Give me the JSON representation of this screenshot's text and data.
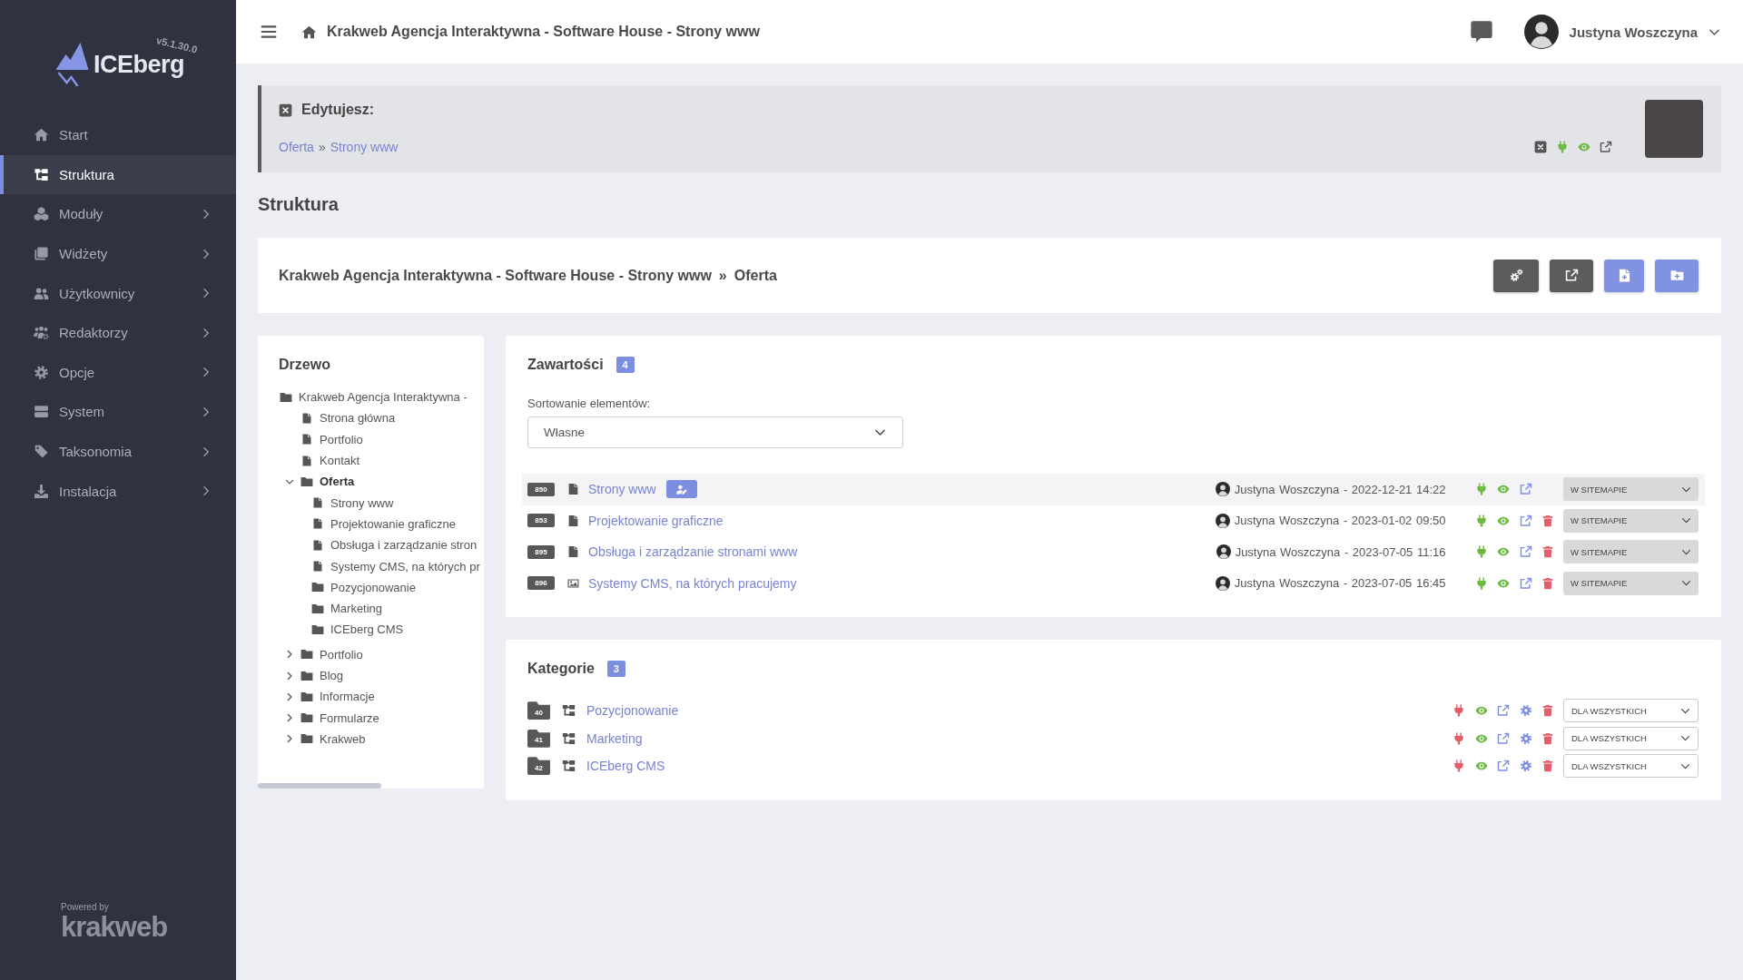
{
  "sidebar": {
    "logo": {
      "name": "ICEberg",
      "version": "v5.1.30.0"
    },
    "items": [
      {
        "label": "Start",
        "selected": false
      },
      {
        "label": "Struktura",
        "selected": true
      },
      {
        "label": "Moduły",
        "selected": false,
        "expanded": false
      },
      {
        "label": "Widżety",
        "selected": false,
        "expanded": false
      },
      {
        "label": "Użytkownicy",
        "selected": false,
        "expanded": false
      },
      {
        "label": "Redaktorzy",
        "selected": false,
        "expanded": false
      },
      {
        "label": "Opcje",
        "selected": false,
        "expanded": false
      },
      {
        "label": "System",
        "selected": false,
        "expanded": false
      },
      {
        "label": "Taksonomia",
        "selected": false,
        "expanded": false
      },
      {
        "label": "Instalacja",
        "selected": false,
        "expanded": false
      }
    ],
    "footer": {
      "caption": "Powered by",
      "brand": "krakweb"
    }
  },
  "header": {
    "title": "Krakweb Agencja Interaktywna - Software House - Strony www",
    "user": "Justyna Woszczyna"
  },
  "editing": {
    "label": "Edytujesz:",
    "breadcrumb": [
      "Oferta",
      "Strony www"
    ],
    "separator": "»",
    "active": true
  },
  "page_title": "Struktura",
  "path_bar": {
    "path": [
      "Krakweb Agencja Interaktywna - Software House - Strony www",
      "Oferta"
    ],
    "separator": "»"
  },
  "tree": {
    "title": "Drzewo",
    "items": [
      {
        "label": "Krakweb Agencja Interaktywna -",
        "kind": "folder",
        "selected": false,
        "children": [
          {
            "label": "Strona główna",
            "kind": "page",
            "selected": false
          },
          {
            "label": "Portfolio",
            "kind": "page",
            "selected": false
          },
          {
            "label": "Kontakt",
            "kind": "page",
            "selected": false
          },
          {
            "label": "Oferta",
            "kind": "folder",
            "selected": true,
            "expanded": true,
            "children": [
              {
                "label": "Strony www",
                "kind": "page",
                "selected": false
              },
              {
                "label": "Projektowanie graficzne",
                "kind": "page",
                "selected": false
              },
              {
                "label": "Obsługa i zarządzanie stron",
                "kind": "page",
                "selected": false
              },
              {
                "label": "Systemy CMS, na których pr",
                "kind": "page",
                "selected": false
              },
              {
                "label": "Pozycjonowanie",
                "kind": "folder",
                "selected": false
              },
              {
                "label": "Marketing",
                "kind": "folder",
                "selected": false
              },
              {
                "label": "ICEberg CMS",
                "kind": "folder",
                "selected": false
              }
            ]
          },
          {
            "label": "Portfolio",
            "kind": "folder",
            "selected": false,
            "expanded": false
          },
          {
            "label": "Blog",
            "kind": "folder",
            "selected": false,
            "expanded": false
          },
          {
            "label": "Informacje",
            "kind": "folder",
            "selected": false,
            "expanded": false
          },
          {
            "label": "Formularze",
            "kind": "folder",
            "selected": false,
            "expanded": false
          },
          {
            "label": "Krakweb",
            "kind": "folder",
            "selected": false,
            "expanded": false
          }
        ]
      }
    ]
  },
  "content": {
    "title": "Zawartości",
    "count": "4",
    "sort_label": "Sortowanie elementów:",
    "sort_value": "Własne",
    "rows": [
      {
        "id": "850",
        "kind": "page",
        "title": "Strony www",
        "byline": "Justyna Woszczyna - 2022-12-21 14:22",
        "active": true,
        "deletable": false,
        "visibility": "W SITEMAPIE",
        "selected": true
      },
      {
        "id": "853",
        "kind": "page",
        "title": "Projektowanie graficzne",
        "byline": "Justyna Woszczyna - 2023-01-02 09:50",
        "active": true,
        "deletable": true,
        "visibility": "W SITEMAPIE",
        "selected": false
      },
      {
        "id": "895",
        "kind": "page",
        "title": "Obsługa i zarządzanie stronami www",
        "byline": "Justyna Woszczyna - 2023-07-05 11:16",
        "active": true,
        "deletable": true,
        "visibility": "W SITEMAPIE",
        "selected": false
      },
      {
        "id": "896",
        "kind": "gallery",
        "title": "Systemy CMS, na których pracujemy",
        "byline": "Justyna Woszczyna - 2023-07-05 16:45",
        "active": true,
        "deletable": true,
        "visibility": "W SITEMAPIE",
        "selected": false
      }
    ]
  },
  "categories": {
    "title": "Kategorie",
    "count": "3",
    "rows": [
      {
        "id": "40",
        "title": "Pozycjonowanie",
        "active": false,
        "access": "DLA WSZYSTKICH"
      },
      {
        "id": "41",
        "title": "Marketing",
        "active": false,
        "access": "DLA WSZYSTKICH"
      },
      {
        "id": "42",
        "title": "ICEberg CMS",
        "active": false,
        "access": "DLA WSZYSTKICH"
      }
    ]
  }
}
